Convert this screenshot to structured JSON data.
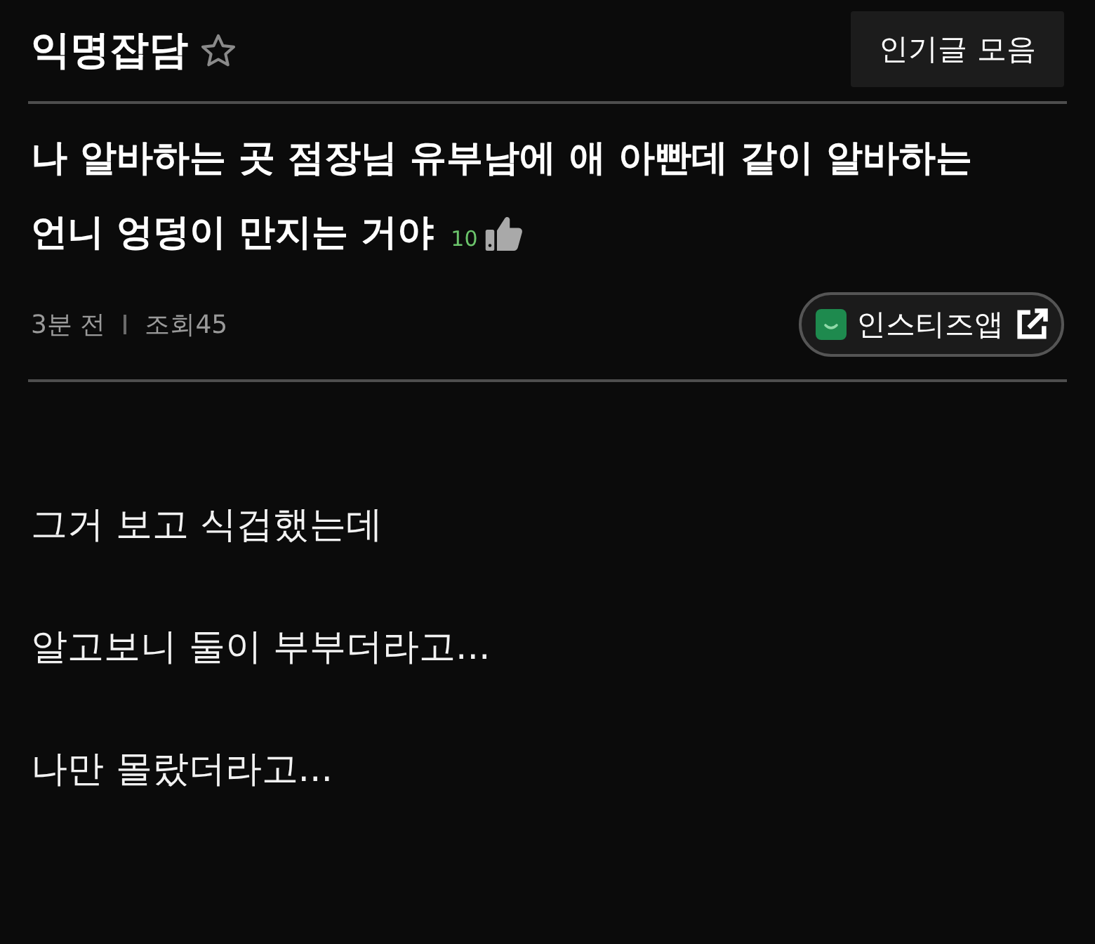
{
  "board": {
    "title": "익명잡담",
    "favorited": false,
    "popular_button": "인기글 모음"
  },
  "post": {
    "title_lines": [
      "나 알바하는 곳 점장님 유부남에 애 아빤데 같이 알바하는",
      "언니 엉덩이 만지는 거야"
    ],
    "likes": "10",
    "time": "3분 전",
    "views": "조회45",
    "app_button": "인스티즈앱"
  },
  "body": [
    "그거 보고 식겁했는데",
    "알고보니 둘이 부부더라고...",
    "나만 몰랐더라고..."
  ]
}
